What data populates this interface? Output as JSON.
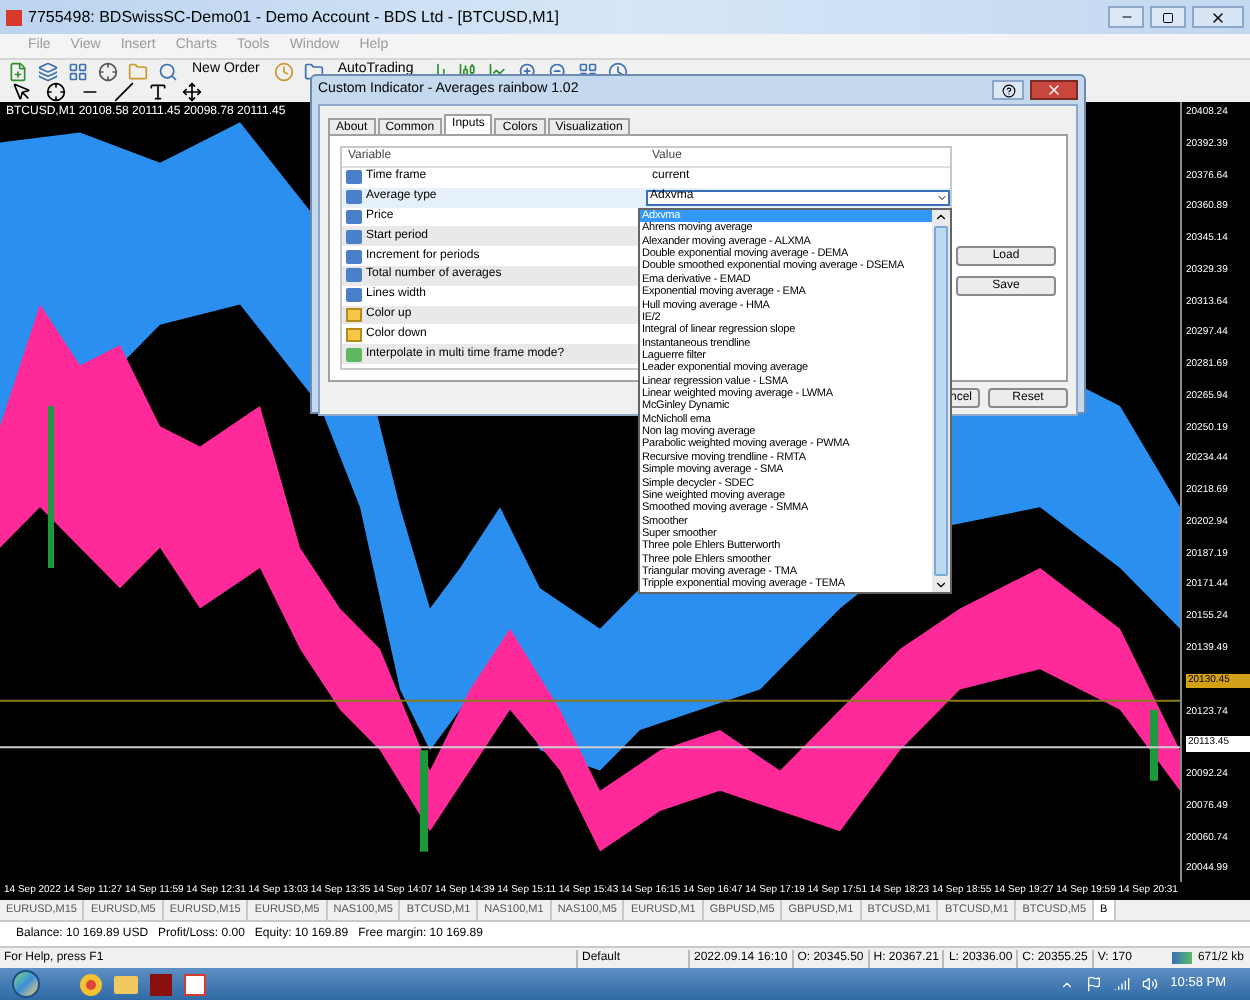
{
  "window": {
    "title": "7755498: BDSwissSC-Demo01 - Demo Account - BDS Ltd - [BTCUSD,M1]"
  },
  "menu": [
    "File",
    "View",
    "Insert",
    "Charts",
    "Tools",
    "Window",
    "Help"
  ],
  "toolbar": {
    "new_order": "New Order",
    "auto_trading": "AutoTrading"
  },
  "chart": {
    "header": "BTCUSD,M1  20108.58 20111.45 20098.78 20111.45",
    "price_labels": [
      {
        "kind": "tick",
        "text": "20408.24"
      },
      {
        "kind": "tick",
        "text": "20392.39"
      },
      {
        "kind": "tick",
        "text": "20376.64"
      },
      {
        "kind": "tick",
        "text": "20360.89"
      },
      {
        "kind": "tick",
        "text": "20345.14"
      },
      {
        "kind": "tick",
        "text": "20329.39"
      },
      {
        "kind": "tick",
        "text": "20313.64"
      },
      {
        "kind": "tick",
        "text": "20297.44"
      },
      {
        "kind": "tick",
        "text": "20281.69"
      },
      {
        "kind": "tick",
        "text": "20265.94"
      },
      {
        "kind": "tick",
        "text": "20250.19"
      },
      {
        "kind": "tick",
        "text": "20234.44"
      },
      {
        "kind": "tick",
        "text": "20218.69"
      },
      {
        "kind": "tick",
        "text": "20202.94"
      },
      {
        "kind": "tick",
        "text": "20187.19"
      },
      {
        "kind": "tick",
        "text": "20171.44"
      },
      {
        "kind": "tick",
        "text": "20155.24"
      },
      {
        "kind": "tick",
        "text": "20139.49"
      },
      {
        "kind": "ask",
        "text": "20130.45"
      },
      {
        "kind": "tick",
        "text": "20123.74"
      },
      {
        "kind": "bid",
        "text": "20113.45"
      },
      {
        "kind": "tick",
        "text": "20092.24"
      },
      {
        "kind": "tick",
        "text": "20076.49"
      },
      {
        "kind": "tick",
        "text": "20060.74"
      },
      {
        "kind": "tick",
        "text": "20044.99"
      }
    ],
    "time_labels": [
      "14 Sep 2022",
      "14 Sep 11:27",
      "14 Sep 11:59",
      "14 Sep 12:31",
      "14 Sep 13:03",
      "14 Sep 13:35",
      "14 Sep 14:07",
      "14 Sep 14:39",
      "14 Sep 15:11",
      "14 Sep 15:43",
      "14 Sep 16:15",
      "14 Sep 16:47",
      "14 Sep 17:19",
      "14 Sep 17:51",
      "14 Sep 18:23",
      "14 Sep 18:55",
      "14 Sep 19:27",
      "14 Sep 19:59",
      "14 Sep 20:31"
    ]
  },
  "chart_tabs": [
    {
      "label": "EURUSD,M15",
      "selected": false
    },
    {
      "label": "EURUSD,M5",
      "selected": false
    },
    {
      "label": "EURUSD,M15",
      "selected": false
    },
    {
      "label": "EURUSD,M5",
      "selected": false
    },
    {
      "label": "NAS100,M5",
      "selected": false
    },
    {
      "label": "BTCUSD,M1",
      "selected": false
    },
    {
      "label": "NAS100,M1",
      "selected": false
    },
    {
      "label": "NAS100,M5",
      "selected": false
    },
    {
      "label": "EURUSD,M1",
      "selected": false
    },
    {
      "label": "GBPUSD,M5",
      "selected": false
    },
    {
      "label": "GBPUSD,M1",
      "selected": false
    },
    {
      "label": "BTCUSD,M1",
      "selected": false
    },
    {
      "label": "BTCUSD,M1",
      "selected": false
    },
    {
      "label": "BTCUSD,M5",
      "selected": false
    },
    {
      "label": "B",
      "selected": true
    }
  ],
  "account": [
    "Balance: 10 169.89 USD",
    "Profit/Loss: 0.00",
    "Equity: 10 169.89",
    "Free margin: 10 169.89"
  ],
  "status_bar": {
    "help": "For Help, press F1",
    "profile": "Default",
    "time": "2022.09.14 16:10",
    "open": "O: 20345.50",
    "high": "H: 20367.21",
    "low": "L: 20336.00",
    "close": "C: 20355.25",
    "volume": "V: 170",
    "traffic": "671/2 kb"
  },
  "taskbar": {
    "clock": "10:58 PM"
  },
  "dialog": {
    "title": "Custom Indicator - Averages rainbow 1.02",
    "tabs": [
      {
        "label": "About",
        "selected": false
      },
      {
        "label": "Common",
        "selected": false
      },
      {
        "label": "Inputs",
        "selected": true
      },
      {
        "label": "Colors",
        "selected": false
      },
      {
        "label": "Visualization",
        "selected": false
      }
    ],
    "columns": [
      "Variable",
      "Value"
    ],
    "rows": [
      {
        "kind": "param",
        "name": "Time frame",
        "value": "current",
        "selected": false
      },
      {
        "kind": "param",
        "name": "Average type",
        "value": "Adxvma",
        "selected": true
      },
      {
        "kind": "param",
        "name": "Price",
        "selected": false
      },
      {
        "kind": "param",
        "name": "Start period",
        "selected": false
      },
      {
        "kind": "param",
        "name": "Increment for periods",
        "selected": false
      },
      {
        "kind": "param",
        "name": "Total number of averages",
        "selected": false
      },
      {
        "kind": "param",
        "name": "Lines width",
        "selected": false
      },
      {
        "kind": "color",
        "name": "Color up",
        "selected": false
      },
      {
        "kind": "color",
        "name": "Color down",
        "selected": false
      },
      {
        "kind": "bool",
        "name": "Interpolate in multi time frame mode?",
        "selected": false
      }
    ],
    "buttons": [
      "Load",
      "Save",
      "ncel",
      "Reset"
    ],
    "dropdown": [
      {
        "label": "Adxvma",
        "selected": true
      },
      {
        "label": "Ahrens moving average",
        "selected": false
      },
      {
        "label": "Alexander moving average - ALXMA",
        "selected": false
      },
      {
        "label": "Double exponential moving average - DEMA",
        "selected": false
      },
      {
        "label": "Double smoothed exponential moving average - DSEMA",
        "selected": false
      },
      {
        "label": "Ema derivative - EMAD",
        "selected": false
      },
      {
        "label": "Exponential moving average - EMA",
        "selected": false
      },
      {
        "label": "Hull moving average - HMA",
        "selected": false
      },
      {
        "label": "IE/2",
        "selected": false
      },
      {
        "label": "Integral of linear regression slope",
        "selected": false
      },
      {
        "label": "Instantaneous trendline",
        "selected": false
      },
      {
        "label": "Laguerre filter",
        "selected": false
      },
      {
        "label": "Leader exponential moving average",
        "selected": false
      },
      {
        "label": "Linear regression value - LSMA",
        "selected": false
      },
      {
        "label": "Linear weighted moving average - LWMA",
        "selected": false
      },
      {
        "label": "McGinley Dynamic",
        "selected": false
      },
      {
        "label": "McNicholl ema",
        "selected": false
      },
      {
        "label": "Non lag moving average",
        "selected": false
      },
      {
        "label": "Parabolic weighted moving average - PWMA",
        "selected": false
      },
      {
        "label": "Recursive moving trendline - RMTA",
        "selected": false
      },
      {
        "label": "Simple moving average - SMA",
        "selected": false
      },
      {
        "label": "Simple decycler - SDEC",
        "selected": false
      },
      {
        "label": "Sine weighted moving average",
        "selected": false
      },
      {
        "label": "Smoothed moving average - SMMA",
        "selected": false
      },
      {
        "label": "Smoother",
        "selected": false
      },
      {
        "label": "Super smoother",
        "selected": false
      },
      {
        "label": "Three pole Ehlers Butterworth",
        "selected": false
      },
      {
        "label": "Three pole Ehlers smoother",
        "selected": false
      },
      {
        "label": "Triangular moving average - TMA",
        "selected": false
      },
      {
        "label": "Tripple exponential moving average - TEMA",
        "selected": false
      }
    ]
  }
}
